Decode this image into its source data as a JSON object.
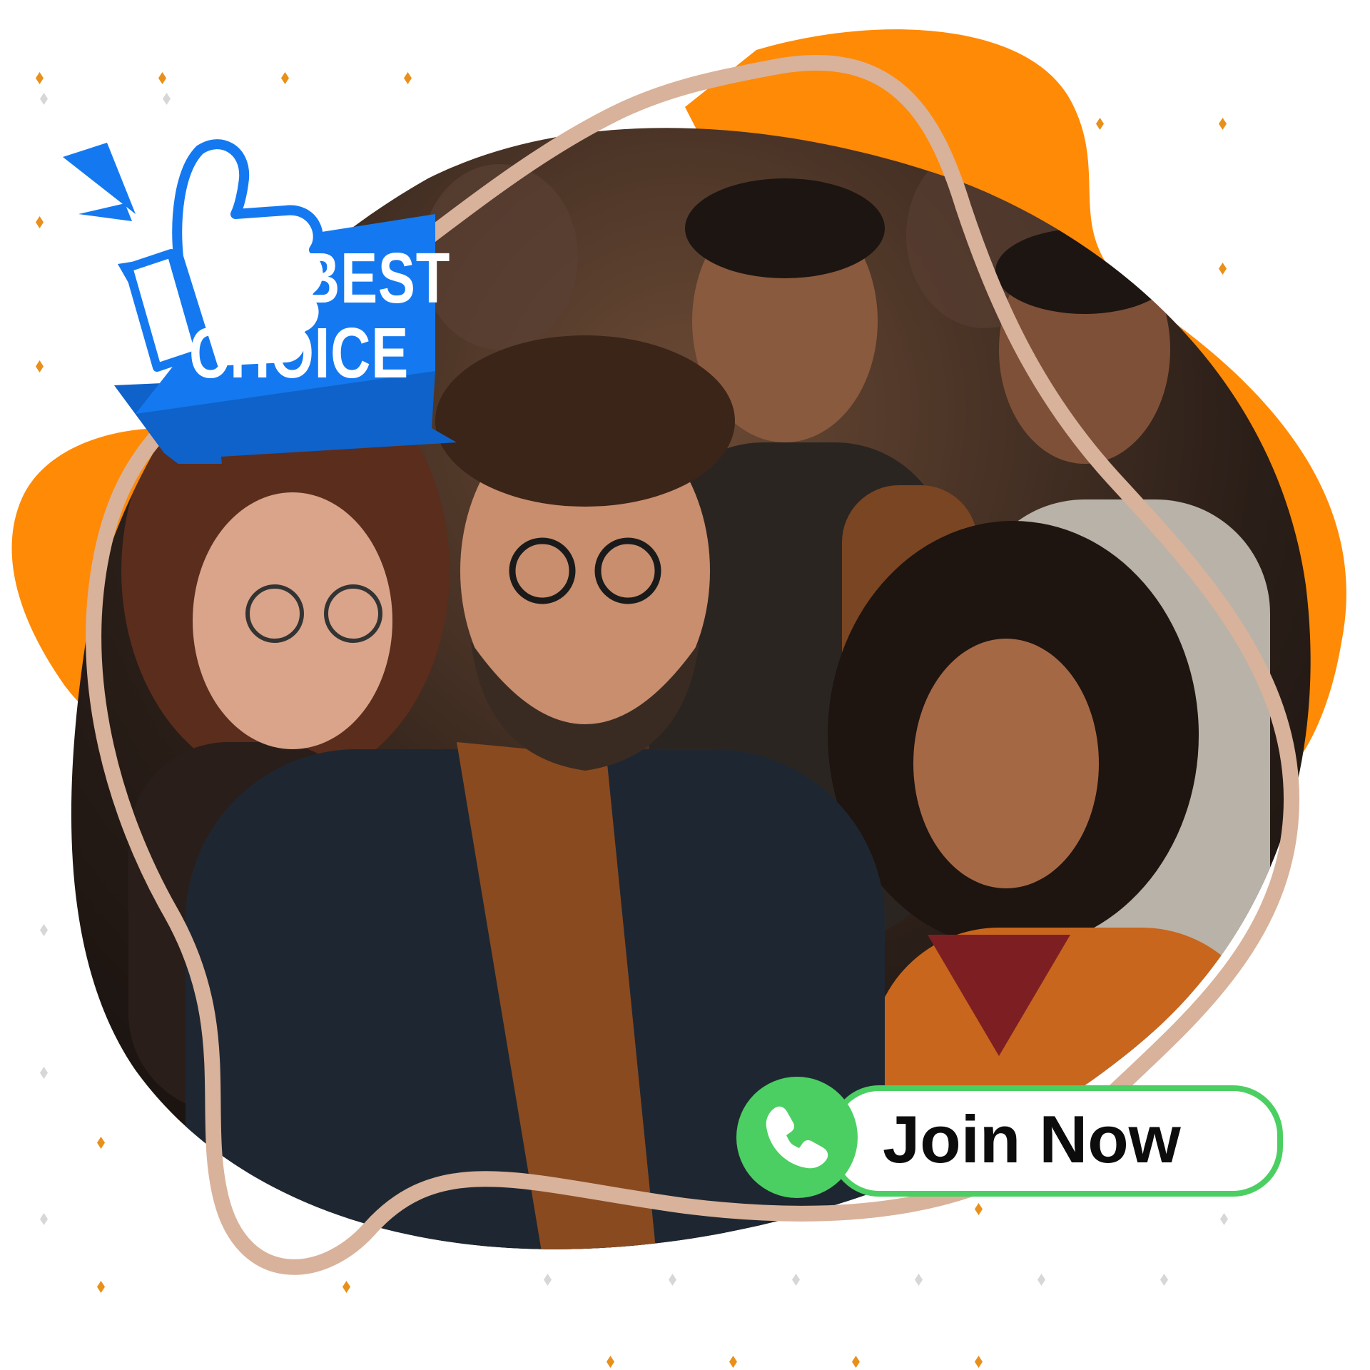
{
  "badge": {
    "line1": "BEST",
    "line2": "CHOICE",
    "icon": "thumbs-up-icon",
    "color": "#1479f0"
  },
  "cta": {
    "label": "Join Now",
    "icon": "phone-icon",
    "color": "#4ccf62"
  },
  "colors": {
    "accent_orange": "#ff8a06",
    "frame_outline": "#d8b29a",
    "background": "#ffffff"
  }
}
